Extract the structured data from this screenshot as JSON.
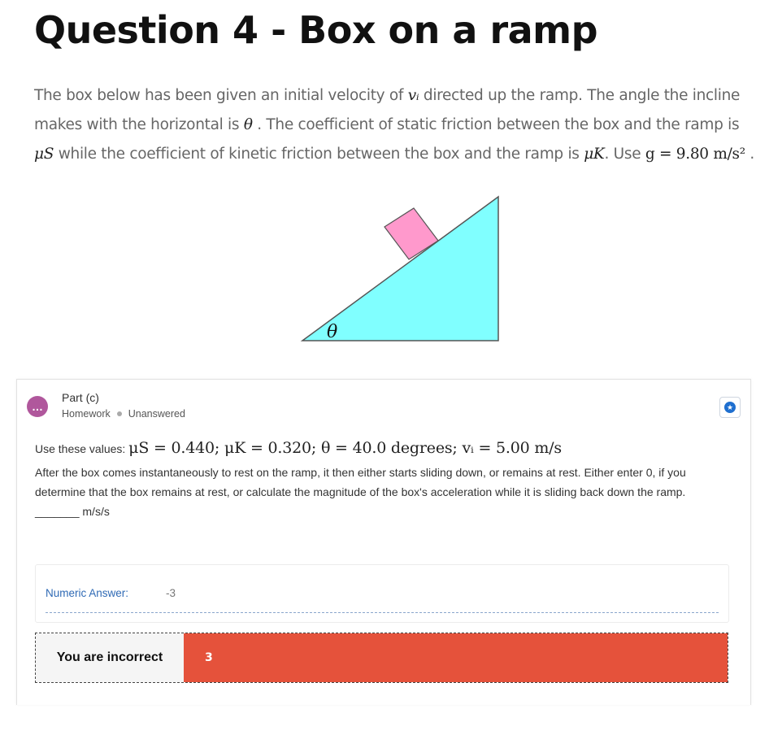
{
  "page": {
    "title": "Question 4 - Box on a ramp"
  },
  "intro": {
    "t1": "The box below has been given an initial velocity of ",
    "v_i": "vᵢ",
    "t2": " directed up the ramp. The angle the incline makes with the horizontal is ",
    "theta": "θ",
    "t3": " . The coefficient of static friction between the box and the ramp is ",
    "mu_s": "μS",
    "t4": " while the coefficient of kinetic friction between the box and the ramp is ",
    "mu_k": "μK",
    "t5": ". Use ",
    "g_eq": "g = 9.80 m/s²",
    "t6": " ."
  },
  "figure": {
    "angle_label": "θ",
    "colors": {
      "ramp": "#80ffff",
      "box": "#ff99cc",
      "outline": "#555555"
    }
  },
  "part": {
    "icon_glyph": "…",
    "title": "Part (c)",
    "type": "Homework",
    "status": "Unanswered",
    "star_glyph": "★",
    "values_prefix": "Use these values: ",
    "values_math": "μS = 0.440; μK = 0.320; θ = 40.0 degrees; vᵢ = 5.00 m/s",
    "question_text": "After the box comes instantaneously to rest on the ramp, it then either starts sliding down, or remains at rest. Either enter 0, if you determine that the box remains at rest, or calculate the magnitude of the box's acceleration while it is sliding back down the ramp.",
    "unit_line": "_______ m/s/s"
  },
  "answer": {
    "label": "Numeric Answer:",
    "value": "-3"
  },
  "feedback": {
    "label": "You are incorrect",
    "submitted": "3",
    "color": "#e5523b"
  }
}
